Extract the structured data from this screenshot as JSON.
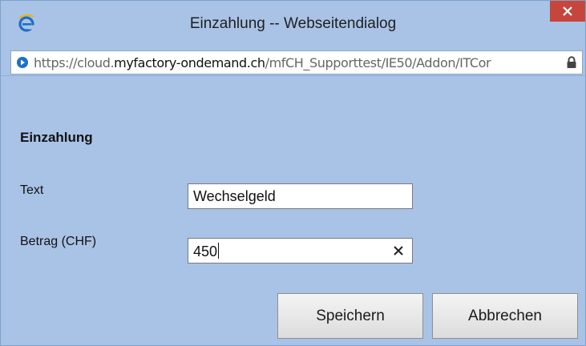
{
  "window": {
    "title": "Einzahlung -- Webseitendialog",
    "close_symbol": "×"
  },
  "address_bar": {
    "scheme": "https://",
    "host_prefix": "cloud.",
    "host_main": "myfactory-ondemand.ch",
    "path": "/mfCH_Supporttest/IE50/Addon/ITCor"
  },
  "form": {
    "heading": "Einzahlung",
    "text_label": "Text",
    "text_value": "Wechselgeld",
    "amount_label": "Betrag (CHF)",
    "amount_value": "450",
    "clear_symbol": "✕"
  },
  "buttons": {
    "save": "Speichern",
    "cancel": "Abbrechen"
  },
  "colors": {
    "background": "#a9c3e6",
    "close_button": "#c7463c"
  }
}
